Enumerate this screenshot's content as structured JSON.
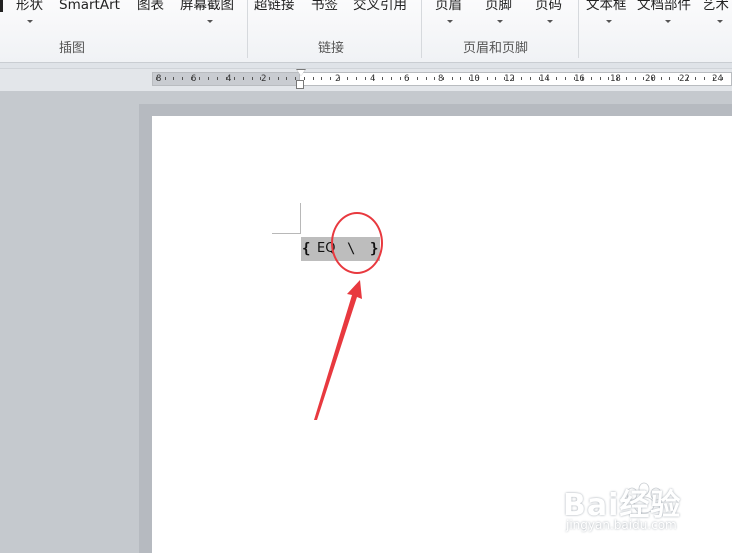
{
  "ribbon": {
    "buttons": [
      "形状",
      "SmartArt",
      "图表",
      "屏幕截图",
      "超链接",
      "书签",
      "交叉引用",
      "页眉",
      "页脚",
      "页码",
      "文本框",
      "文档部件",
      "艺术"
    ],
    "groups": [
      "插图",
      "链接",
      "页眉和页脚"
    ]
  },
  "ruler": {
    "numbers": [
      "8",
      "6",
      "4",
      "2",
      "2",
      "4",
      "6",
      "8",
      "10",
      "12",
      "14",
      "16",
      "18",
      "20",
      "22",
      "24"
    ]
  },
  "document": {
    "field_open": "{",
    "field_code": "EQ",
    "field_backslash": "\\",
    "field_close": "}"
  },
  "annotation": {
    "color": "#e8393f"
  },
  "watermark": {
    "text": "Bai经验",
    "url": "jingyan.baidu.com"
  }
}
